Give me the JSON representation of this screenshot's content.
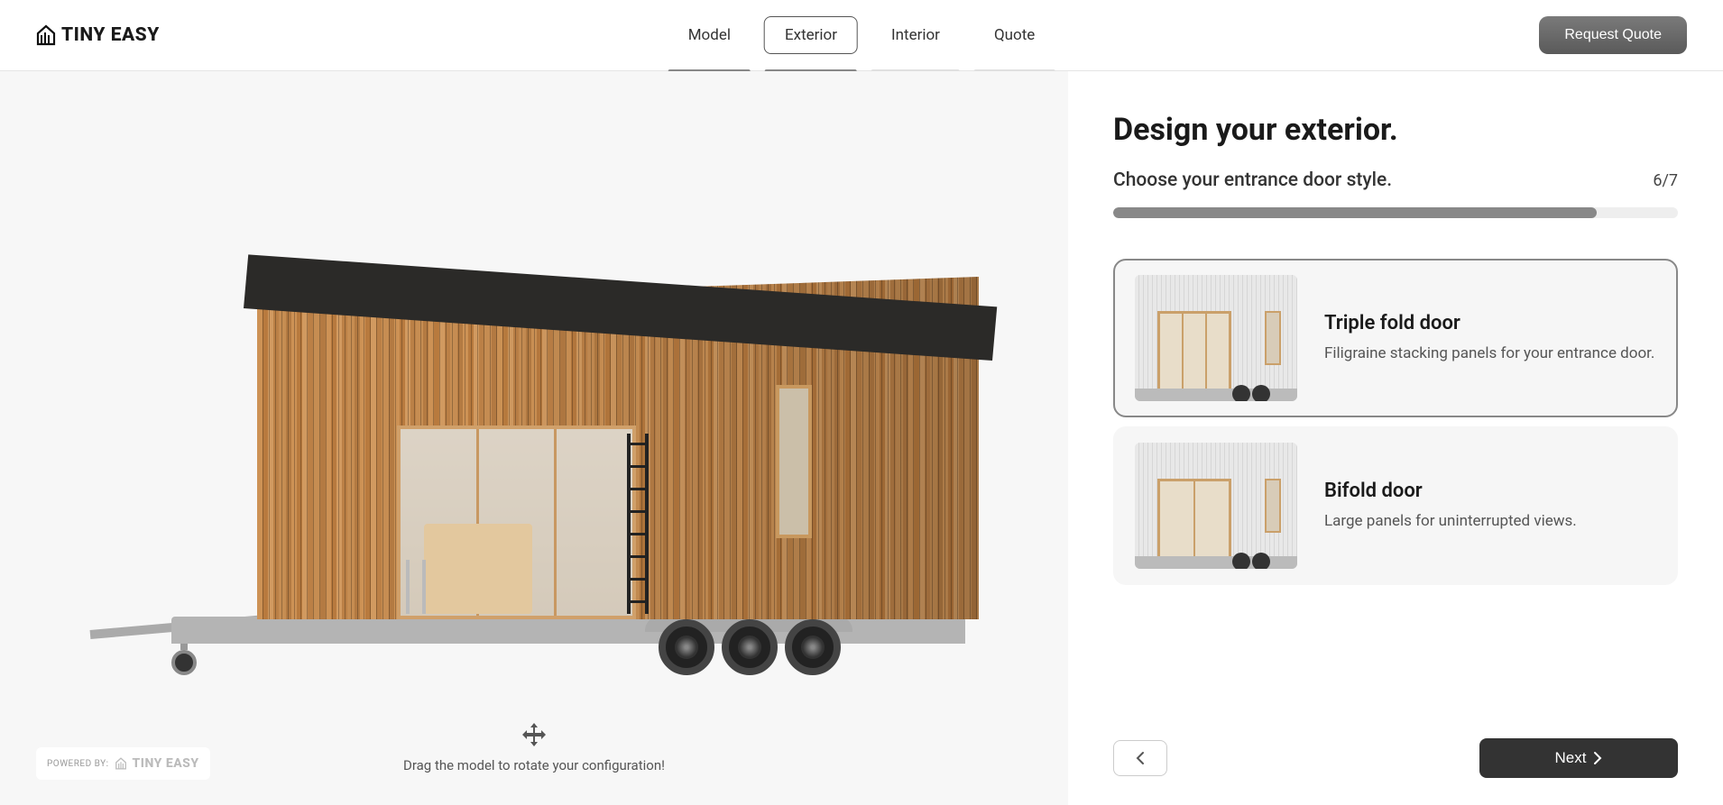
{
  "brand": "TINY EASY",
  "nav": {
    "tabs": [
      {
        "label": "Model",
        "state": "done"
      },
      {
        "label": "Exterior",
        "state": "active"
      },
      {
        "label": "Interior",
        "state": "pending"
      },
      {
        "label": "Quote",
        "state": "pending"
      }
    ]
  },
  "header": {
    "quote_button": "Request Quote"
  },
  "viewer": {
    "hint": "Drag the model to rotate your configuration!"
  },
  "powered_by": {
    "label": "POWERED BY:",
    "vendor": "TINY EASY"
  },
  "panel": {
    "title": "Design your exterior.",
    "subtitle": "Choose your entrance door style.",
    "step": "6/7",
    "progress_percent": 85.7,
    "options": [
      {
        "title": "Triple fold door",
        "description": "Filigraine stacking panels for your entrance door.",
        "selected": true,
        "panels": 3
      },
      {
        "title": "Bifold door",
        "description": "Large panels for uninterrupted views.",
        "selected": false,
        "panels": 2
      }
    ],
    "back_label": "Back",
    "next_label": "Next"
  }
}
